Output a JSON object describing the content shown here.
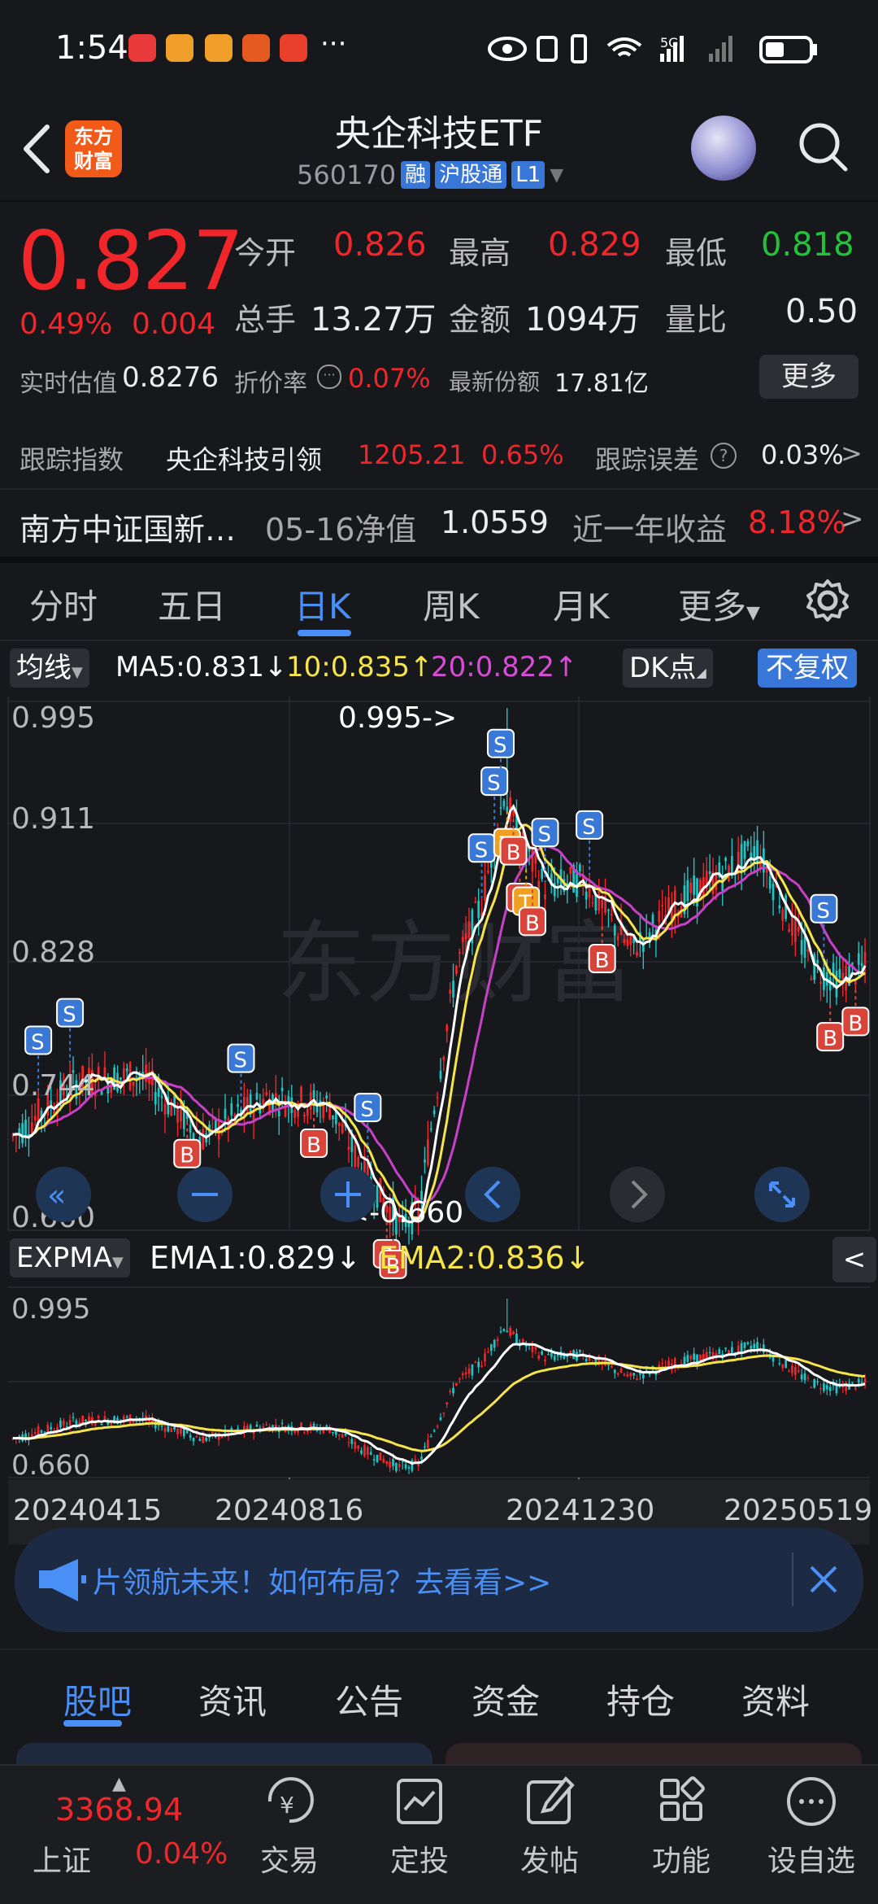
{
  "status_bar": {
    "time": "1:54",
    "dots": "···",
    "network": "5G"
  },
  "header": {
    "back_label": "<",
    "logo_text_line1": "东方",
    "logo_text_line2": "财富",
    "title": "央企科技ETF",
    "code": "560170",
    "tag_margin": "融",
    "tag_connect": "沪股通",
    "tag_level": "L1"
  },
  "quote": {
    "price": "0.827",
    "change_pct": "0.49%",
    "change_abs": "0.004",
    "open_label": "今开",
    "open": "0.826",
    "high_label": "最高",
    "high": "0.829",
    "low_label": "最低",
    "low": "0.818",
    "volume_label": "总手",
    "volume": "13.27万",
    "amount_label": "金额",
    "amount": "1094万",
    "ratio_label": "量比",
    "ratio": "0.50",
    "iopv_label": "实时估值",
    "iopv": "0.8276",
    "discount_label": "折价率",
    "discount": "0.07%",
    "shares_label": "最新份额",
    "shares": "17.81亿",
    "more_label": "更多"
  },
  "tracking": {
    "label": "跟踪指数",
    "index_name": "央企科技引领",
    "index_value": "1205.21",
    "index_change": "0.65%",
    "error_label": "跟踪误差",
    "error_value": "0.03%",
    "arrow": ">"
  },
  "related_fund": {
    "name": "南方中证国新…",
    "nav_label": "05-16净值",
    "nav": "1.0559",
    "return_label": "近一年收益",
    "return": "8.18%",
    "arrow": ">"
  },
  "kline_tabs": [
    "分时",
    "五日",
    "日K",
    "周K",
    "月K",
    "更多"
  ],
  "kline_active": "日K",
  "ma_bar": {
    "indicator": "均线",
    "ma5": "MA5:0.831↓",
    "ma10": "10:0.835↑",
    "ma20": "20:0.822↑",
    "dk_label": "DK点",
    "adjust_label": "不复权"
  },
  "main_chart": {
    "y_labels": [
      "0.995",
      "0.911",
      "0.828",
      "0.744",
      "0.660"
    ],
    "max_label": "0.995->",
    "min_label": "<-0.660",
    "watermark": "东方财富"
  },
  "sub_chart": {
    "indicator": "EXPMA",
    "ema1": "EMA1:0.829↓",
    "ema2": "EMA2:0.836↓",
    "y_labels": [
      "0.995",
      "0.660"
    ],
    "x_labels": [
      "20240415",
      "20240816",
      "20241230",
      "20250519"
    ]
  },
  "colors": {
    "up": "#f0262a",
    "down": "#22c3c3",
    "ma5": "#ffffff",
    "ma10": "#f5e44a",
    "ma20": "#c840c8",
    "accent": "#4a8ff5"
  },
  "banner": {
    "text": "片领航未来！如何布局？去看看>>"
  },
  "bottom_tabs": [
    "股吧",
    "资讯",
    "公告",
    "资金",
    "持仓",
    "资料"
  ],
  "bottom_tab_active": "股吧",
  "index_ticker": {
    "name": "上证",
    "value": "3368.94",
    "change": "0.04%"
  },
  "nav": [
    "交易",
    "定投",
    "发帖",
    "功能",
    "设自选"
  ]
}
